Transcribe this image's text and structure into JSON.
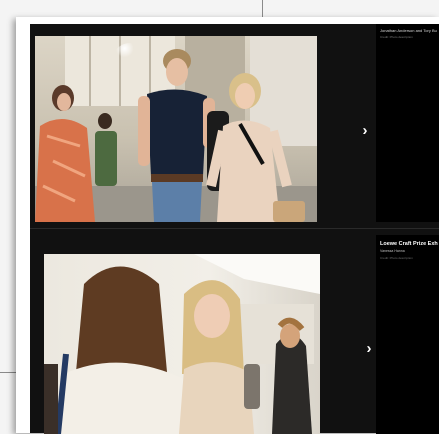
{
  "gallery": {
    "items": [
      {
        "caption_title": "Jonathan Anderson and Tory Bu",
        "caption_sub": "Credit: Photo description",
        "caption_sub2": "",
        "next_icon": "chevron-right-icon",
        "next_glyph": "›"
      },
      {
        "caption_title": "Loewe Craft Prize Exh",
        "caption_sub": "Vanessa Hanna",
        "caption_sub2": "Credit: Photo description",
        "next_icon": "chevron-right-icon",
        "next_glyph": "›"
      }
    ]
  },
  "colors": {
    "gallery_background": "#111111",
    "side_panel": "#000000",
    "frame": "#ffffff"
  }
}
